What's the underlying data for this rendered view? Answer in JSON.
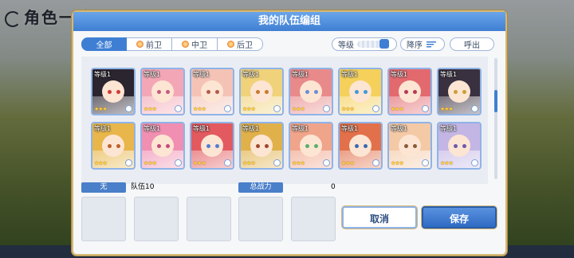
{
  "background": {
    "title": "角色一览"
  },
  "dialog": {
    "title": "我的队伍编组",
    "filters": [
      {
        "label": "全部",
        "active": true
      },
      {
        "label": "前卫",
        "active": false
      },
      {
        "label": "中卫",
        "active": false
      },
      {
        "label": "后卫",
        "active": false
      }
    ],
    "sort_field_label": "等级",
    "sort_order_label": "降序",
    "call_label": "呼出",
    "rows": [
      {
        "cards": [
          {
            "level": "等级1",
            "stars": "★★★",
            "hair": "#2b2530",
            "eye": "#d33a3a"
          },
          {
            "level": "等级1",
            "stars": "★★★",
            "hair": "#f3a7b6",
            "eye": "#c45a7d"
          },
          {
            "level": "等级1",
            "stars": "★★★",
            "hair": "#f4c3b6",
            "eye": "#b25a4a"
          },
          {
            "level": "等级1",
            "stars": "★★★",
            "hair": "#f0d27a",
            "eye": "#c87a2f"
          },
          {
            "level": "等级1",
            "stars": "★★★",
            "hair": "#e88a8a",
            "eye": "#6a8fd3"
          },
          {
            "level": "等级1",
            "stars": "★★★",
            "hair": "#f5d05a",
            "eye": "#3f9ad3"
          },
          {
            "level": "等级1",
            "stars": "★★★",
            "hair": "#e26a6f",
            "eye": "#b43a54"
          },
          {
            "level": "等级1",
            "stars": "★★★",
            "hair": "#3a3140",
            "eye": "#c8a03a"
          }
        ]
      },
      {
        "cards": [
          {
            "level": "等级1",
            "stars": "★★★",
            "hair": "#e8b64a",
            "eye": "#c0602a"
          },
          {
            "level": "等级1",
            "stars": "★★★",
            "hair": "#f08fb1",
            "eye": "#c34a7a"
          },
          {
            "level": "等级1",
            "stars": "★★★",
            "hair": "#e25a5f",
            "eye": "#4f7fd3"
          },
          {
            "level": "等级1",
            "stars": "★★★",
            "hair": "#e0b04a",
            "eye": "#a0482a"
          },
          {
            "level": "等级1",
            "stars": "★★★",
            "hair": "#f0a48a",
            "eye": "#5ab06a"
          },
          {
            "level": "等级1",
            "stars": "★★★",
            "hair": "#e2704a",
            "eye": "#3a6ab0"
          },
          {
            "level": "等级1",
            "stars": "★★★",
            "hair": "#f4c9a6",
            "eye": "#8a5a3a"
          },
          {
            "level": "等级1",
            "stars": "★★★",
            "hair": "#c3b6e4",
            "eye": "#6a5ab0"
          }
        ]
      }
    ],
    "team_chip": "无",
    "team_name": "队伍10",
    "power_label": "总战力",
    "power_value": "0",
    "cancel_label": "取消",
    "save_label": "保存"
  },
  "colors": {
    "accent": "#3f7fd3",
    "frame_gold": "#d6b874"
  }
}
